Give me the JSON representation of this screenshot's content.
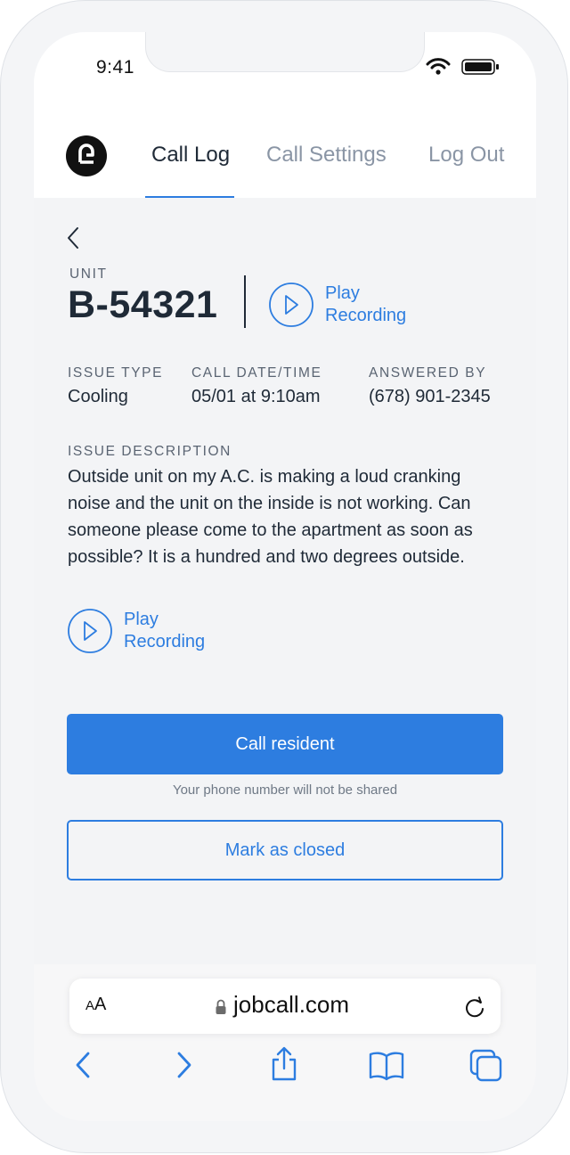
{
  "status_bar": {
    "time": "9:41"
  },
  "nav": {
    "tabs": [
      {
        "label": "Call Log",
        "active": true
      },
      {
        "label": "Call Settings",
        "active": false
      },
      {
        "label": "Log Out",
        "active": false
      }
    ]
  },
  "detail": {
    "unit_label": "UNIT",
    "unit_value": "B-54321",
    "play_recording_1": {
      "line1": "Play",
      "line2": "Recording"
    },
    "issue_type_label": "ISSUE TYPE",
    "issue_type_value": "Cooling",
    "call_datetime_label": "CALL DATE/TIME",
    "call_datetime_value": "05/01 at 9:10am",
    "answered_by_label": "ANSWERED BY",
    "answered_by_value": "(678) 901-2345",
    "issue_description_label": "ISSUE DESCRIPTION",
    "issue_description_value": "Outside unit on my A.C. is making a loud cranking noise and the unit on the inside is not working. Can someone please come to the apartment as soon as possible? It is a hundred and two degrees outside.",
    "play_recording_2": {
      "line1": "Play",
      "line2": "Recording"
    }
  },
  "actions": {
    "call_resident_label": "Call resident",
    "privacy_note": "Your phone number will not be shared",
    "mark_closed_label": "Mark as closed"
  },
  "browser": {
    "text_size_label_small": "A",
    "text_size_label_large": "A",
    "url": "jobcall.com"
  },
  "colors": {
    "accent": "#2d7de0",
    "text": "#1f2a37",
    "muted": "#8a95a5"
  }
}
